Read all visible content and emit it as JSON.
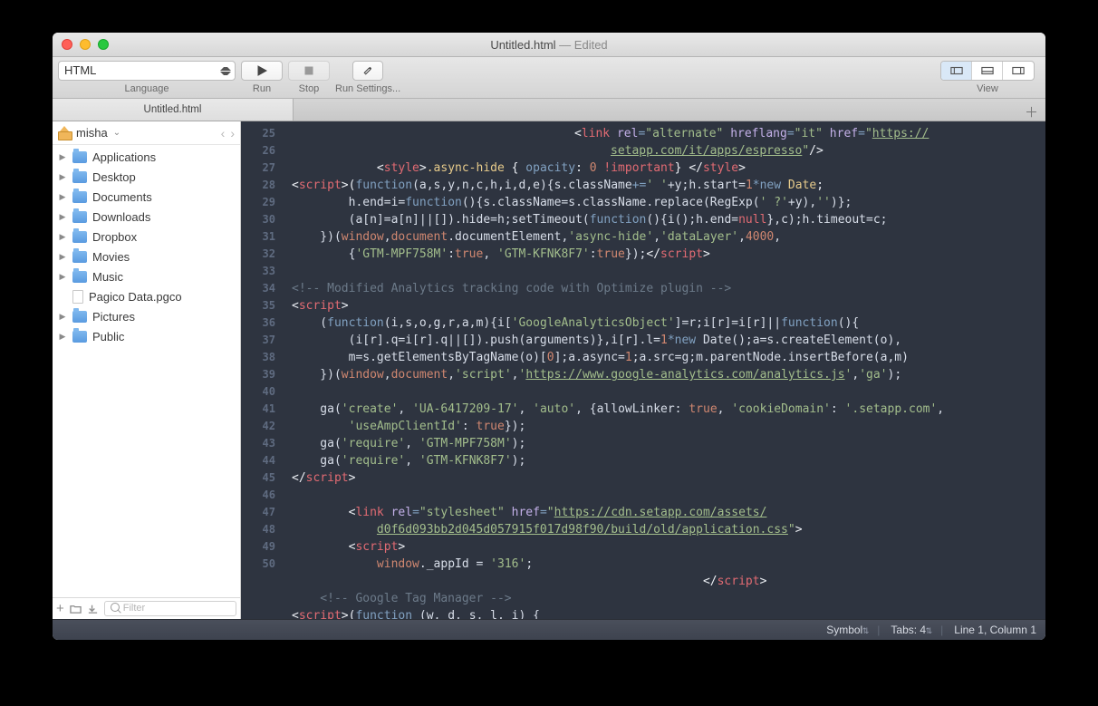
{
  "titlebar": {
    "filename": "Untitled.html",
    "status": "Edited"
  },
  "toolbar": {
    "language": {
      "value": "HTML",
      "label": "Language"
    },
    "run": "Run",
    "stop": "Stop",
    "run_settings": "Run Settings...",
    "view": "View"
  },
  "tabs": {
    "active": "Untitled.html"
  },
  "sidebar": {
    "crumb": "misha",
    "items": [
      {
        "name": "Applications",
        "type": "folder"
      },
      {
        "name": "Desktop",
        "type": "folder"
      },
      {
        "name": "Documents",
        "type": "folder"
      },
      {
        "name": "Downloads",
        "type": "folder"
      },
      {
        "name": "Dropbox",
        "type": "folder"
      },
      {
        "name": "Movies",
        "type": "folder"
      },
      {
        "name": "Music",
        "type": "folder"
      },
      {
        "name": "Pagico Data.pgco",
        "type": "file"
      },
      {
        "name": "Pictures",
        "type": "folder"
      },
      {
        "name": "Public",
        "type": "folder"
      }
    ],
    "filter_placeholder": "Filter"
  },
  "gutter": [
    "25",
    "26",
    "27",
    "28",
    "29",
    "30",
    "31",
    "32",
    "33",
    "34",
    "35",
    "36",
    "37",
    "38",
    "39",
    "40",
    "41",
    "42",
    "43",
    "44",
    "45",
    "46",
    "47",
    "48",
    "49",
    "50"
  ],
  "code": {
    "l25a": "<",
    "l25tag": "link",
    "l25sp": " ",
    "l25a1": "rel",
    "l25eq": "=",
    "l25v1": "\"alternate\"",
    "l25a2": "hreflang",
    "l25v2": "\"it\"",
    "l25a3": "href",
    "l25v3a": "\"",
    "l25v3u": "https://",
    "l25end": "",
    "l25b_u": "setapp.com/it/apps/espresso",
    "l25b_q": "\"",
    "l25b_cl": "/>",
    "l26_o": "<",
    "l26_t": "style",
    "l26_c": ">",
    "l26_sel": ".async-hide",
    "l26_b": " { ",
    "l26_p": "opacity",
    "l26_col": ": ",
    "l26_n": "0",
    "l26_imp": " !important",
    "l26_b2": "} ",
    "l26_ct": "</",
    "l26_t2": "style",
    "l26_c2": ">",
    "l27_o": "<",
    "l27_t": "script",
    "l27_c": ">(",
    "l27_fn": "function",
    "l27_args": "(a,s,y,n,c,h,i,d,e){s.className",
    "l27_op": "+=",
    "l27_s": "' '",
    "l27_r1": "+y;h.start=",
    "l27_n1": "1",
    "l27_r2": "*",
    "l27_new": "new",
    "l27_d": " Date",
    "l27_sc": ";",
    "l28_a": "        h.end=i=",
    "l28_fn": "function",
    "l28_b": "(){s.className=s.className.replace(RegExp(",
    "l28_s": "' ?'",
    "l28_c": "+y),",
    "l28_s2": "''",
    "l28_d": ")};",
    "l29_a": "        (a[n]=a[n]||[]).hide=h;setTimeout(",
    "l29_fn": "function",
    "l29_b": "(){i();h.end=",
    "l29_nu": "null",
    "l29_c": "},c);h.timeout=c;",
    "l30_a": "    })(",
    "l30_w": "window",
    "l30_c1": ",",
    "l30_d": "document",
    "l30_b": ".documentElement,",
    "l30_s1": "'async-hide'",
    "l30_c2": ",",
    "l30_s2": "'dataLayer'",
    "l30_c3": ",",
    "l30_n": "4000",
    "l30_c4": ",",
    "l31_a": "        {",
    "l31_s1": "'GTM-MPF758M'",
    "l31_c": ":",
    "l31_t": "true",
    "l31_cm": ", ",
    "l31_s2": "'GTM-KFNK8F7'",
    "l31_c2": ":",
    "l31_t2": "true",
    "l31_b": "});",
    "l31_ct": "</",
    "l31_tag": "script",
    "l31_cl": ">",
    "l33": "<!-- Modified Analytics tracking code with Optimize plugin -->",
    "l34_o": "<",
    "l34_t": "script",
    "l34_c": ">",
    "l35_a": "    (",
    "l35_fn": "function",
    "l35_b": "(i,s,o,g,r,a,m){i[",
    "l35_s": "'GoogleAnalyticsObject'",
    "l35_c": "]=r;i[r]=i[r]||",
    "l35_fn2": "function",
    "l35_d": "(){",
    "l36_a": "        (i[r].q=i[r].q||[]).push(arguments)},i[r].l=",
    "l36_n": "1",
    "l36_b": "*",
    "l36_new": "new",
    "l36_c": " Date();a=s.createElement(o),",
    "l37_a": "        m=s.getElementsByTagName(o)[",
    "l37_n": "0",
    "l37_b": "];a.async=",
    "l37_n2": "1",
    "l37_c": ";a.src=g;m.parentNode.insertBefore(a,m)",
    "l38_a": "    })(",
    "l38_w": "window",
    "l38_c1": ",",
    "l38_d": "document",
    "l38_c2": ",",
    "l38_s1": "'script'",
    "l38_c3": ",",
    "l38_s2": "'",
    "l38_u": "https://www.google-analytics.com/analytics.js",
    "l38_s2b": "'",
    "l38_c4": ",",
    "l38_s3": "'ga'",
    "l38_e": ");",
    "l40_a": "    ga(",
    "l40_s1": "'create'",
    "l40_c1": ", ",
    "l40_s2": "'UA-6417209-17'",
    "l40_c2": ", ",
    "l40_s3": "'auto'",
    "l40_c3": ", {allowLinker: ",
    "l40_t": "true",
    "l40_c4": ", ",
    "l40_s4": "'cookieDomain'",
    "l40_c5": ": ",
    "l40_s5": "'.setapp.com'",
    "l40_c6": ",",
    "l41_a": "        ",
    "l41_s": "'useAmpClientId'",
    "l41_c": ": ",
    "l41_t": "true",
    "l41_e": "});",
    "e41_a": "    ga(",
    "e41_s1": "'require'",
    "e41_c": ", ",
    "e41_s2": "'GTM-MPF758M'",
    "e41_e": ");",
    "l42_a": "    ga(",
    "l42_s1": "'require'",
    "l42_c": ", ",
    "l42_s2": "'GTM-KFNK8F7'",
    "l42_e": ");",
    "l43_o": "</",
    "l43_t": "script",
    "l43_c": ">",
    "l45_a": "        <",
    "l45_t": "link",
    "l45_sp": " ",
    "l45_a1": "rel",
    "l45_eq": "=",
    "l45_v1": "\"stylesheet\"",
    "l45_a2": " href",
    "l45_eq2": "=",
    "l45_q": "\"",
    "l45_u1": "https://cdn.setapp.com/assets/",
    "l45b_u": "d0f6d093bb2d045d057915f017d98f90/build/old/application.css",
    "l45b_q": "\"",
    "l45b_c": ">",
    "l46_a": "        <",
    "l46_t": "script",
    "l46_c": ">",
    "l47_a": "            ",
    "l47_w": "window",
    "l47_b": "._appId = ",
    "l47_s": "'316'",
    "l47_e": ";",
    "l48_a": "                                                          </",
    "l48_t": "script",
    "l48_c": ">",
    "l49": "    <!-- Google Tag Manager -->",
    "l50_o": "<",
    "l50_t": "script",
    "l50_c": ">(",
    "l50_fn": "function",
    "l50_args": " (w, d, s, l, i) {"
  },
  "statusbar": {
    "symbol": "Symbol",
    "tabs": "Tabs: 4",
    "pos": "Line 1, Column 1"
  }
}
